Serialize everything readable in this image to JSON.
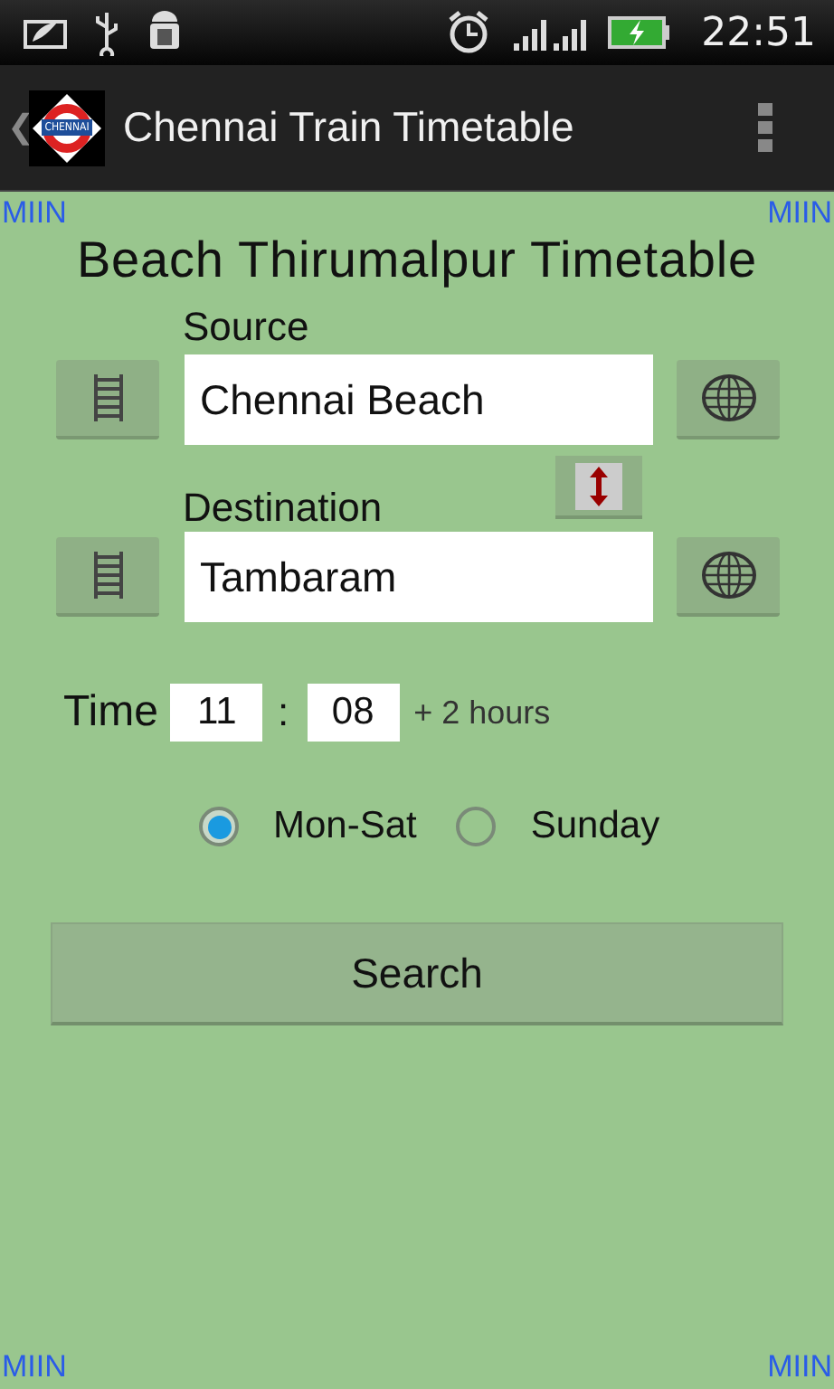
{
  "status_bar": {
    "time": "22:51"
  },
  "app_bar": {
    "back": "❮",
    "logo_text": "CHENNAI",
    "title": "Chennai Train Timetable"
  },
  "corner_marks": {
    "top_left": "MIIN",
    "top_right": "MIIN",
    "bottom_left": "MIIN",
    "bottom_right": "MIIN"
  },
  "heading": "Beach Thirumalpur Timetable",
  "source": {
    "label": "Source",
    "value": "Chennai Beach"
  },
  "destination": {
    "label": "Destination",
    "value": "Tambaram"
  },
  "time": {
    "label": "Time",
    "hour": "11",
    "separator": ":",
    "minute": "08",
    "note": "+ 2 hours"
  },
  "day_options": [
    {
      "label": "Mon-Sat",
      "selected": true
    },
    {
      "label": "Sunday",
      "selected": false
    }
  ],
  "search_button": "Search"
}
